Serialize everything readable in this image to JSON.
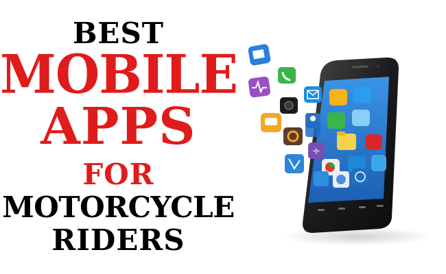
{
  "headline": {
    "line1": "BEST",
    "line2": "MOBILE",
    "line3": "APPS",
    "line4": "FOR",
    "line5": "MOTORCYCLE",
    "line6": "RIDERS"
  },
  "colors": {
    "red": "#e01b1b",
    "black": "#000000",
    "phone_body": "#1c1c1e",
    "screen": "#2f7fd6"
  },
  "app_icons": [
    "calendar-icon",
    "heartbeat-icon",
    "phone-icon",
    "mail-icon",
    "chat-icon",
    "camera-icon",
    "gear-icon",
    "wifi-icon",
    "compass-icon",
    "contacts-icon",
    "pie-chart-icon",
    "globe-icon",
    "folder-icon",
    "calculator-icon",
    "map-icon"
  ]
}
